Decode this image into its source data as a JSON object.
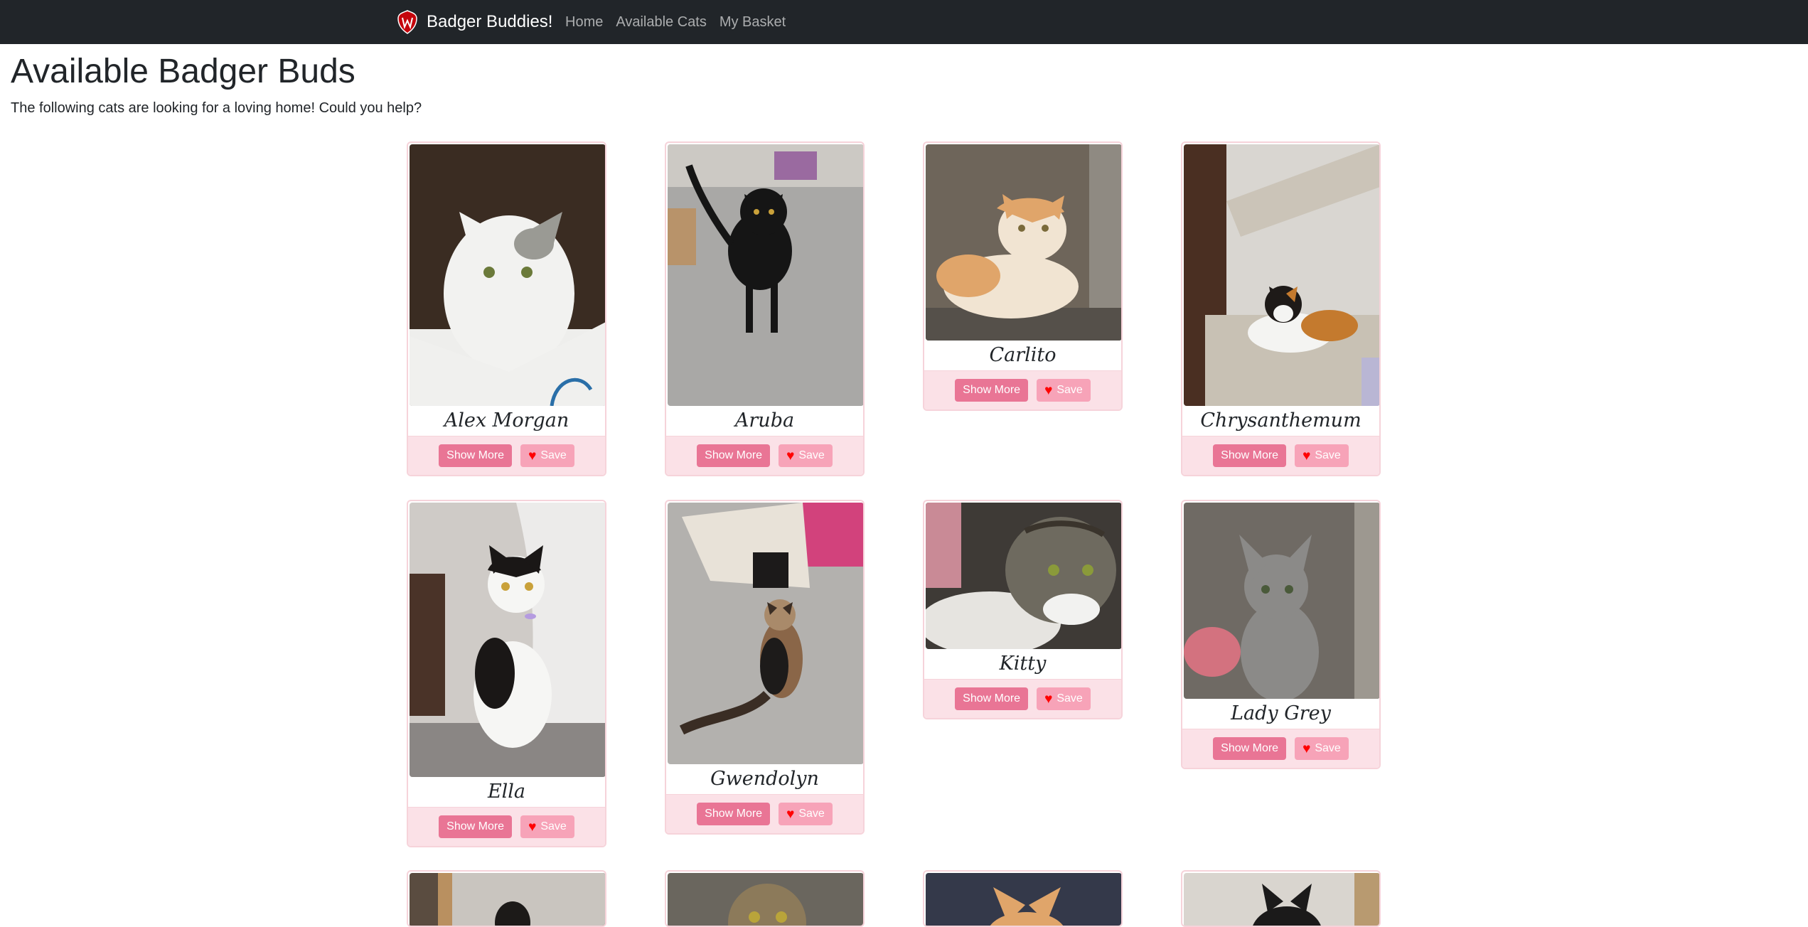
{
  "nav": {
    "brand": "Badger Buddies!",
    "links": [
      "Home",
      "Available Cats",
      "My Basket"
    ]
  },
  "page": {
    "title": "Available Badger Buds",
    "subtitle": "The following cats are looking for a loving home! Could you help?"
  },
  "buttons": {
    "show_more": "Show More",
    "save": "Save"
  },
  "cats": [
    {
      "name": "Alex Morgan"
    },
    {
      "name": "Aruba"
    },
    {
      "name": "Carlito"
    },
    {
      "name": "Chrysanthemum"
    },
    {
      "name": "Ella"
    },
    {
      "name": "Gwendolyn"
    },
    {
      "name": "Kitty"
    },
    {
      "name": "Lady Grey"
    }
  ],
  "colors": {
    "navbar": "#212529",
    "card_border": "#f6d3da",
    "footer_bg": "#fbe1e7",
    "show_more_button": "#e97595",
    "save_button": "#f7a3b8",
    "heart": "#ff0000"
  }
}
